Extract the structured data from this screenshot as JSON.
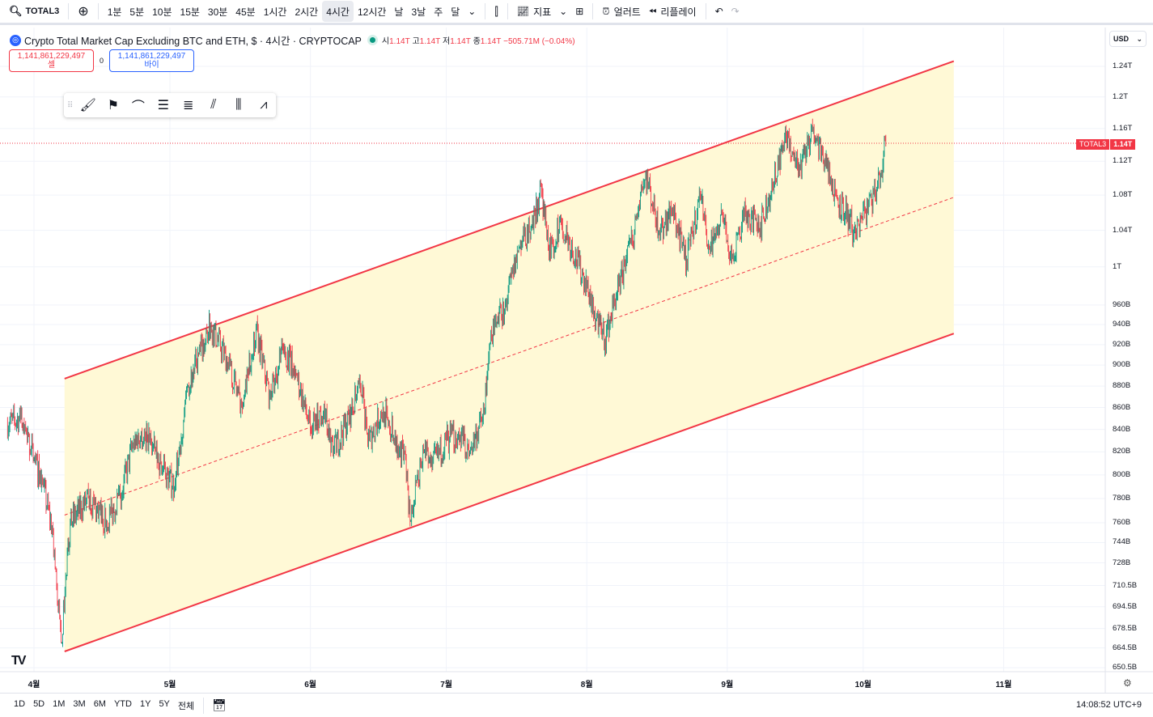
{
  "toolbar": {
    "symbol": "TOTAL3",
    "intervals": [
      "1분",
      "5분",
      "10분",
      "15분",
      "30분",
      "45분",
      "1시간",
      "2시간",
      "4시간",
      "12시간",
      "날",
      "3날",
      "주",
      "달"
    ],
    "active_interval": "4시간",
    "indicators": "지표",
    "alert": "얼러트",
    "replay": "리플레이"
  },
  "legend": {
    "title": "Crypto Total Market Cap Excluding BTC and ETH, $ · 4시간 · CRYPTOCAP",
    "o_label": "시",
    "o": "1.14T",
    "h_label": "고",
    "h": "1.14T",
    "l_label": "저",
    "l": "1.14T",
    "c_label": "종",
    "c": "1.14T",
    "change": "−505.71M (−0.04%)"
  },
  "trade": {
    "sell_price": "1,141,861,229,497",
    "sell_label": "셀",
    "spread": "0",
    "buy_price": "1,141,861,229,497",
    "buy_label": "바이"
  },
  "currency": "USD",
  "price_tag": {
    "symbol": "TOTAL3",
    "value": "1.14T"
  },
  "bottom": {
    "ranges": [
      "1D",
      "5D",
      "1M",
      "3M",
      "6M",
      "YTD",
      "1Y",
      "5Y",
      "전체"
    ],
    "clock": "14:08:52 UTC+9"
  },
  "colors": {
    "up": "#089981",
    "down": "#f23645",
    "channel": "#f23645",
    "channel_fill": "#fff9d6"
  },
  "chart_data": {
    "type": "candlestick",
    "scale": "log",
    "y_ticks": [
      "1.24T",
      "1.2T",
      "1.16T",
      "1.12T",
      "1.08T",
      "1.04T",
      "1T",
      "960B",
      "940B",
      "920B",
      "900B",
      "880B",
      "860B",
      "840B",
      "820B",
      "800B",
      "780B",
      "760B",
      "744B",
      "728B",
      "710.5B",
      "694.5B",
      "678.5B",
      "664.5B",
      "650.5B"
    ],
    "y_tick_values": [
      1240,
      1200,
      1160,
      1120,
      1080,
      1040,
      1000,
      960,
      940,
      920,
      900,
      880,
      860,
      840,
      820,
      800,
      780,
      760,
      744,
      728,
      710.5,
      694.5,
      678.5,
      664.5,
      650.5
    ],
    "x_ticks": [
      {
        "label": "4월",
        "date": "2025-04-01"
      },
      {
        "label": "5월",
        "date": "2025-05-01"
      },
      {
        "label": "6월",
        "date": "2025-06-01"
      },
      {
        "label": "7월",
        "date": "2025-07-01"
      },
      {
        "label": "8월",
        "date": "2025-08-01"
      },
      {
        "label": "9월",
        "date": "2025-09-01"
      },
      {
        "label": "10월",
        "date": "2025-10-01"
      },
      {
        "label": "11월",
        "date": "2025-11-01"
      }
    ],
    "unit": "B USD",
    "last_price": 1141.86,
    "path": [
      [
        "2025-03-26",
        845
      ],
      [
        "2025-03-29",
        850
      ],
      [
        "2025-04-01",
        815
      ],
      [
        "2025-04-03",
        790
      ],
      [
        "2025-04-05",
        755
      ],
      [
        "2025-04-07",
        668
      ],
      [
        "2025-04-09",
        760
      ],
      [
        "2025-04-13",
        780
      ],
      [
        "2025-04-17",
        760
      ],
      [
        "2025-04-20",
        780
      ],
      [
        "2025-04-23",
        830
      ],
      [
        "2025-04-26",
        835
      ],
      [
        "2025-04-30",
        800
      ],
      [
        "2025-05-02",
        790
      ],
      [
        "2025-05-05",
        880
      ],
      [
        "2025-05-10",
        940
      ],
      [
        "2025-05-14",
        900
      ],
      [
        "2025-05-17",
        860
      ],
      [
        "2025-05-20",
        935
      ],
      [
        "2025-05-23",
        870
      ],
      [
        "2025-05-26",
        915
      ],
      [
        "2025-05-29",
        890
      ],
      [
        "2025-06-01",
        840
      ],
      [
        "2025-06-04",
        860
      ],
      [
        "2025-06-06",
        820
      ],
      [
        "2025-06-10",
        855
      ],
      [
        "2025-06-12",
        880
      ],
      [
        "2025-06-14",
        830
      ],
      [
        "2025-06-17",
        860
      ],
      [
        "2025-06-20",
        830
      ],
      [
        "2025-06-22",
        815
      ],
      [
        "2025-06-23",
        762
      ],
      [
        "2025-06-26",
        820
      ],
      [
        "2025-06-28",
        810
      ],
      [
        "2025-07-01",
        830
      ],
      [
        "2025-07-04",
        835
      ],
      [
        "2025-07-06",
        820
      ],
      [
        "2025-07-09",
        850
      ],
      [
        "2025-07-11",
        930
      ],
      [
        "2025-07-14",
        960
      ],
      [
        "2025-07-17",
        1020
      ],
      [
        "2025-07-20",
        1050
      ],
      [
        "2025-07-22",
        1085
      ],
      [
        "2025-07-24",
        1010
      ],
      [
        "2025-07-26",
        1050
      ],
      [
        "2025-07-28",
        1030
      ],
      [
        "2025-08-01",
        980
      ],
      [
        "2025-08-03",
        945
      ],
      [
        "2025-08-05",
        925
      ],
      [
        "2025-08-08",
        980
      ],
      [
        "2025-08-11",
        1030
      ],
      [
        "2025-08-14",
        1105
      ],
      [
        "2025-08-17",
        1040
      ],
      [
        "2025-08-20",
        1065
      ],
      [
        "2025-08-23",
        1005
      ],
      [
        "2025-08-26",
        1080
      ],
      [
        "2025-08-28",
        1020
      ],
      [
        "2025-08-31",
        1055
      ],
      [
        "2025-09-02",
        1010
      ],
      [
        "2025-09-05",
        1060
      ],
      [
        "2025-09-08",
        1040
      ],
      [
        "2025-09-11",
        1090
      ],
      [
        "2025-09-14",
        1150
      ],
      [
        "2025-09-17",
        1110
      ],
      [
        "2025-09-20",
        1160
      ],
      [
        "2025-09-22",
        1130
      ],
      [
        "2025-09-25",
        1080
      ],
      [
        "2025-09-27",
        1060
      ],
      [
        "2025-09-29",
        1040
      ],
      [
        "2025-10-02",
        1065
      ],
      [
        "2025-10-04",
        1085
      ],
      [
        "2025-10-06",
        1142
      ]
    ],
    "channel": {
      "start": "2025-04-07T18:00",
      "end": "2025-10-21T00:00",
      "upper": [
        887,
        1247
      ],
      "lower": [
        662,
        931
      ]
    }
  }
}
